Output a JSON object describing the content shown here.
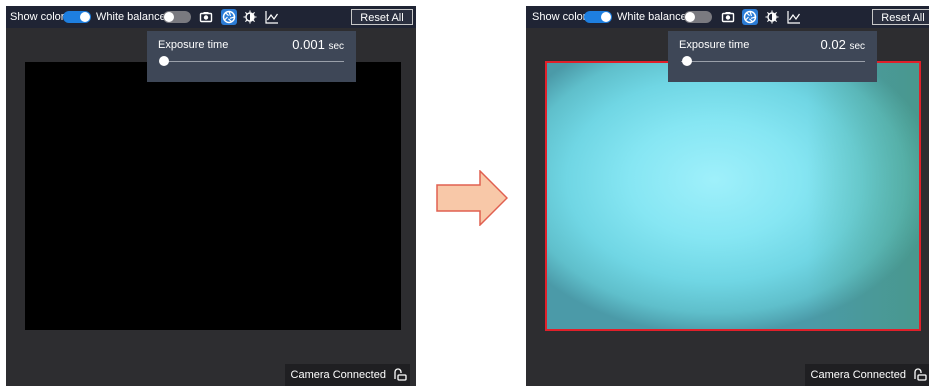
{
  "panels": [
    {
      "toolbar": {
        "show_color_label": "Show color",
        "show_color_on": true,
        "white_balance_label": "White balance",
        "white_balance_on": false,
        "reset_label": "Reset All"
      },
      "exposure": {
        "label": "Exposure time",
        "value": "0.001",
        "unit": "sec",
        "slider_fraction": 0.02
      },
      "view": {
        "fill": "#000000",
        "border": "none"
      },
      "status": {
        "label": "Camera Connected"
      }
    },
    {
      "toolbar": {
        "show_color_label": "Show color",
        "show_color_on": true,
        "white_balance_label": "White balance",
        "white_balance_on": false,
        "reset_label": "Reset All"
      },
      "exposure": {
        "label": "Exposure time",
        "value": "0.02",
        "unit": "sec",
        "slider_fraction": 0.03
      },
      "view": {
        "fill": "cyan-green camera image",
        "border": "#e0202a"
      },
      "status": {
        "label": "Camera Connected"
      }
    }
  ],
  "icons": [
    "camera-icon",
    "aperture-icon",
    "brightness-icon",
    "chart-line-icon",
    "usb-plug-icon",
    "right-arrow-icon"
  ],
  "colors": {
    "toolbar_bg": "#1f2434",
    "panel_bg": "#2d2d30",
    "toggle_on": "#1e7fe0",
    "active_tool": "#2b7cd6",
    "arrow_fill": "#f8c8a8",
    "arrow_stroke": "#e06050",
    "view_border": "#e0202a"
  }
}
